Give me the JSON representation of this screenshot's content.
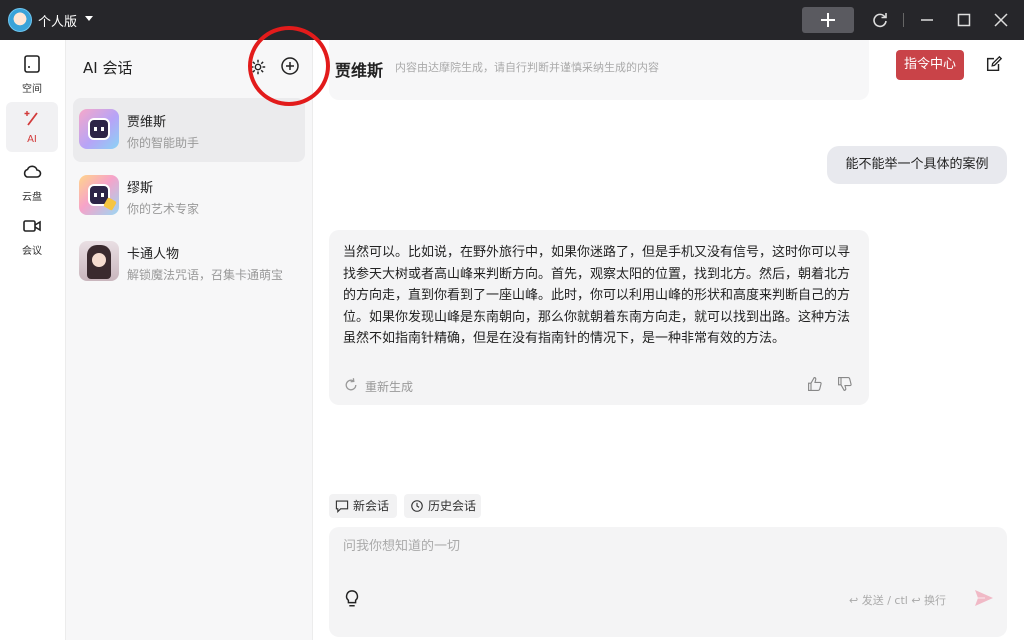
{
  "titlebar": {
    "plan_label": "个人版"
  },
  "nav": {
    "items": [
      {
        "label": "空间",
        "icon": "space-icon"
      },
      {
        "label": "AI",
        "icon": "ai-wand-icon",
        "active": true
      },
      {
        "label": "云盘",
        "icon": "cloud-icon"
      },
      {
        "label": "会议",
        "icon": "video-icon"
      }
    ]
  },
  "sessions": {
    "title": "AI 会话",
    "items": [
      {
        "name": "贾维斯",
        "desc": "你的智能助手",
        "active": true
      },
      {
        "name": "缪斯",
        "desc": "你的艺术专家"
      },
      {
        "name": "卡通人物",
        "desc": "解锁魔法咒语，召集卡通萌宝"
      }
    ]
  },
  "chat": {
    "assistant_name": "贾维斯",
    "disclaimer": "内容由达摩院生成，请自行判断并谨慎采纳生成的内容",
    "command_center": "指令中心",
    "user_message": "能不能举一个具体的案例",
    "ai_message": "当然可以。比如说，在野外旅行中，如果你迷路了，但是手机又没有信号，这时你可以寻找参天大树或者高山峰来判断方向。首先，观察太阳的位置，找到北方。然后，朝着北方的方向走，直到你看到了一座山峰。此时，你可以利用山峰的形状和高度来判断自己的方位。如果你发现山峰是东南朝向，那么你就朝着东南方向走，就可以找到出路。这种方法虽然不如指南针精确，但是在没有指南针的情况下，是一种非常有效的方法。",
    "regenerate": "重新生成",
    "new_chat": "新会话",
    "history": "历史会话",
    "input_placeholder": "问我你想知道的一切",
    "send_hint": "↩ 发送 / ctl ↩ 换行"
  },
  "colors": {
    "accent": "#c94348",
    "titlebar": "#26262a",
    "highlight_circle": "#e21b1b"
  }
}
